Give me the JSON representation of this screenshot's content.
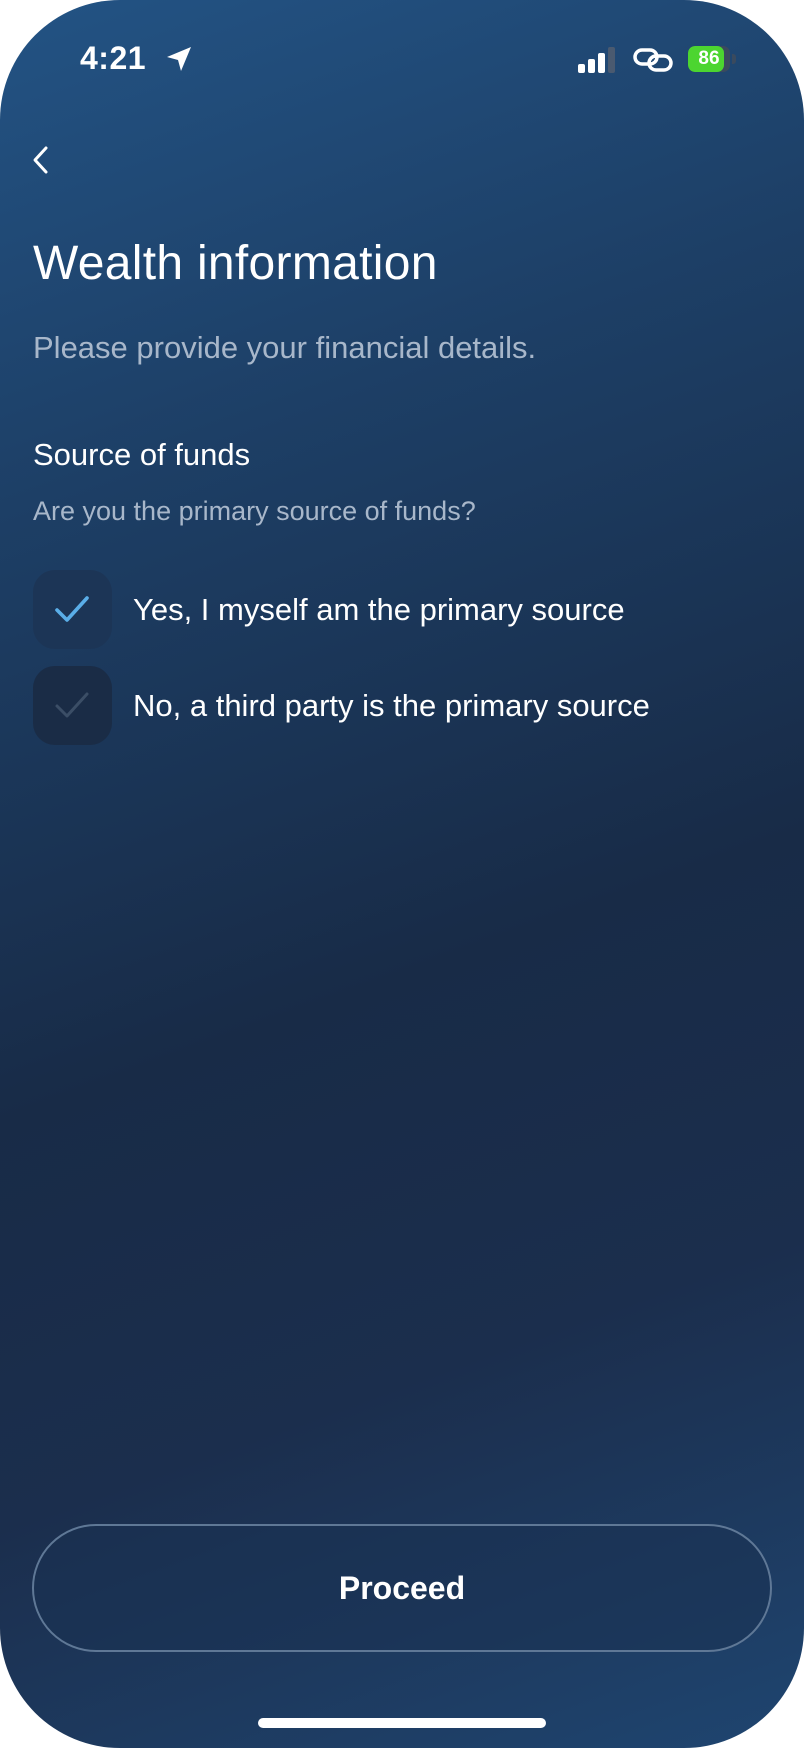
{
  "status_bar": {
    "time": "4:21",
    "battery_level": 86,
    "battery_label": "86",
    "battery_color": "#4cd530",
    "icons": [
      "location-arrow-icon",
      "cellular-signal-icon",
      "link-icon",
      "battery-icon"
    ]
  },
  "header": {
    "back_icon": "chevron-left-icon",
    "title": "Wealth information",
    "subtitle": "Please provide your financial details."
  },
  "section": {
    "title": "Source of funds",
    "question": "Are you the primary source of funds?",
    "options": [
      {
        "label": "Yes, I myself am the primary source",
        "selected": true
      },
      {
        "label": "No, a third party is the primary source",
        "selected": false
      }
    ]
  },
  "footer": {
    "proceed_label": "Proceed"
  },
  "colors": {
    "background_top": "#235384",
    "background_mid": "#182b47",
    "checkmark_selected": "#5aaee8",
    "checkmark_unselected": "#3b4e66",
    "secondary_text": "#a8b7ca"
  }
}
